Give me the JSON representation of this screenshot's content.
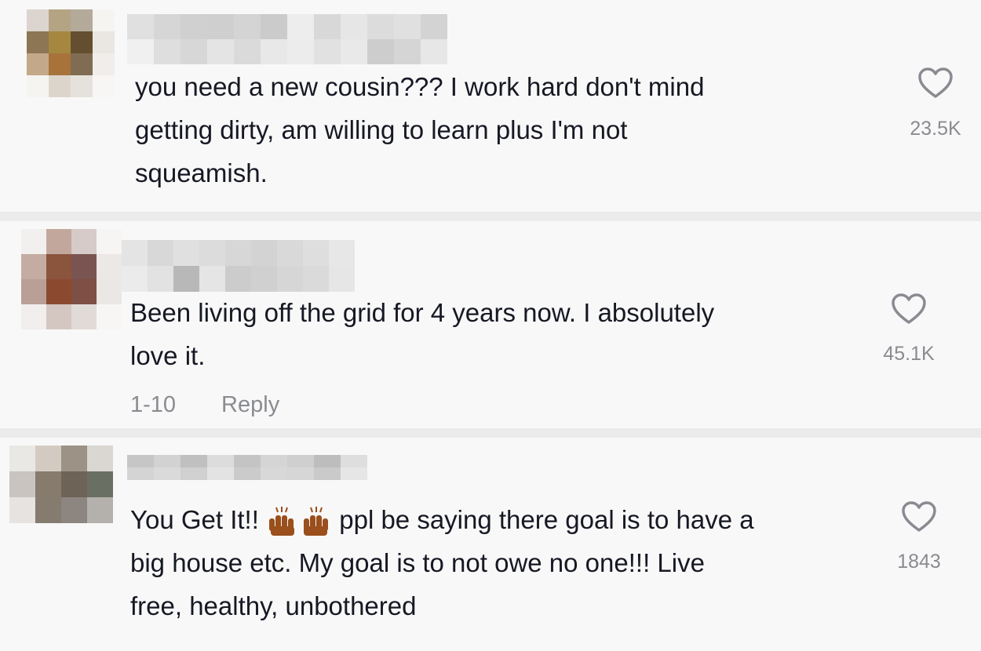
{
  "comments": [
    {
      "text_lines": [
        "you need a new cousin??? I work hard don't mind",
        "getting dirty, am willing to learn plus I'm not",
        "squeamish."
      ],
      "likes": "23.5K"
    },
    {
      "text_lines": [
        "Been living off the grid for 4 years now. I absolutely",
        "love it."
      ],
      "likes": "45.1K",
      "replies": "1-10",
      "reply_label": "Reply"
    },
    {
      "text_a": "You Get It!!",
      "emoji": "raising-hands-emoji",
      "text_b": "ppl be saying there goal is to have a",
      "text_lines": [
        "big house etc. My goal is to not owe no one!!! Live",
        "free, healthy, unbothered"
      ],
      "likes": "1843"
    }
  ],
  "icons": {
    "like": "heart-outline-icon"
  },
  "colors": {
    "background": "#f8f8f8",
    "divider": "#ebebeb",
    "text": "#161823",
    "muted": "#8a8b91"
  }
}
